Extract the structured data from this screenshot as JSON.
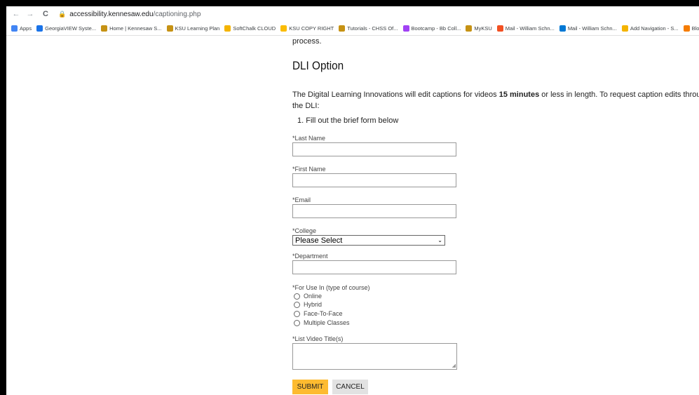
{
  "browser": {
    "back": "←",
    "forward": "→",
    "reload": "C",
    "lock": "🔒",
    "url_host": "accessibility.kennesaw.edu",
    "url_path": "/captioning.php"
  },
  "bookmarks": [
    {
      "label": "Apps",
      "color": "#4285f4"
    },
    {
      "label": "GeorgiaVIEW Syste...",
      "color": "#1a73e8"
    },
    {
      "label": "Home | Kennesaw S...",
      "color": "#c69214"
    },
    {
      "label": "KSU Learning Plan",
      "color": "#c69214"
    },
    {
      "label": "SoftChalk CLOUD",
      "color": "#f4b400"
    },
    {
      "label": "KSU COPY RIGHT",
      "color": "#fbbc04"
    },
    {
      "label": "Tutorials - CHSS Of...",
      "color": "#c69214"
    },
    {
      "label": "Bootcamp - Bb Coll...",
      "color": "#a142f4"
    },
    {
      "label": "MyKSU",
      "color": "#c69214"
    },
    {
      "label": "Mail - William Schn...",
      "color": "#f25022"
    },
    {
      "label": "Mail - William Schn...",
      "color": "#0078d4"
    },
    {
      "label": "Add Navigation - S...",
      "color": "#f4b400"
    },
    {
      "label": "Blo",
      "color": "#f57c00"
    }
  ],
  "page": {
    "process_text": "process.",
    "heading": "DLI Option",
    "intro_before": "The Digital Learning Innovations will edit captions for videos ",
    "intro_bold": "15 minutes",
    "intro_after": " or less in length. To request caption edits through the DLI:",
    "step1": "1. Fill out the brief form below"
  },
  "form": {
    "last_name_label": "*Last Name",
    "first_name_label": "*First Name",
    "email_label": "*Email",
    "college_label": "*College",
    "college_selected": "Please Select",
    "department_label": "*Department",
    "use_label": "*For Use In (type of course)",
    "use_options": [
      "Online",
      "Hybrid",
      "Face-To-Face",
      "Multiple Classes"
    ],
    "video_titles_label": "*List Video Title(s)",
    "submit": "SUBMIT",
    "cancel": "CANCEL"
  }
}
